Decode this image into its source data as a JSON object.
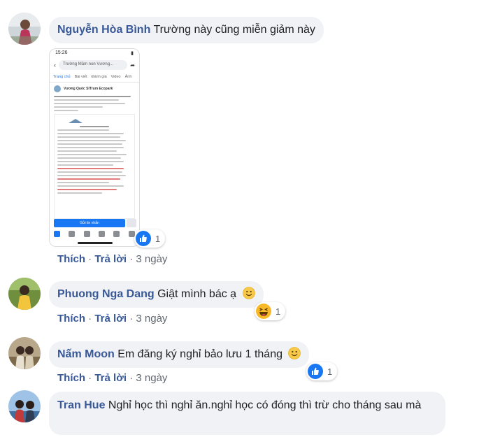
{
  "colors": {
    "author": "#385898",
    "bubble": "#f0f2f5",
    "like": "#1877f2",
    "haha": "#f7b928"
  },
  "comments": [
    {
      "author": "Nguyễn Hòa Bình",
      "text": "Trường này cũng miễn giảm này",
      "attachment": {
        "status_time": "15:26",
        "search_text": "Trường Mầm non Vương...",
        "tabs": [
          "Trang chủ",
          "Bài viết",
          "Đánh giá",
          "Video",
          "Ảnh"
        ],
        "page_name": "Vương Quốc SITrum Ecopark",
        "cta": "Gửi tin nhắn"
      },
      "reaction_icon": "like-icon",
      "reaction_count": "1",
      "actions": {
        "like": "Thích",
        "reply": "Trả lời",
        "time": "3 ngày",
        "sep": "·"
      }
    },
    {
      "author": "Phuong Nga Dang",
      "text": "Giật mình bác ạ",
      "emoji": "smiley-emoji",
      "reaction_icon": "haha-icon",
      "reaction_count": "1",
      "actions": {
        "like": "Thích",
        "reply": "Trả lời",
        "time": "3 ngày",
        "sep": "·"
      }
    },
    {
      "author": "Nấm Moon",
      "text": "Em đăng ký nghỉ bảo lưu 1 tháng",
      "emoji": "smiley-emoji",
      "reaction_icon": "like-icon",
      "reaction_count": "1",
      "actions": {
        "like": "Thích",
        "reply": "Trả lời",
        "time": "3 ngày",
        "sep": "·"
      }
    },
    {
      "author": "Tran Hue",
      "text": "Nghỉ học thì nghỉ ăn.nghỉ học có đóng thì trừ cho tháng sau mà"
    }
  ]
}
